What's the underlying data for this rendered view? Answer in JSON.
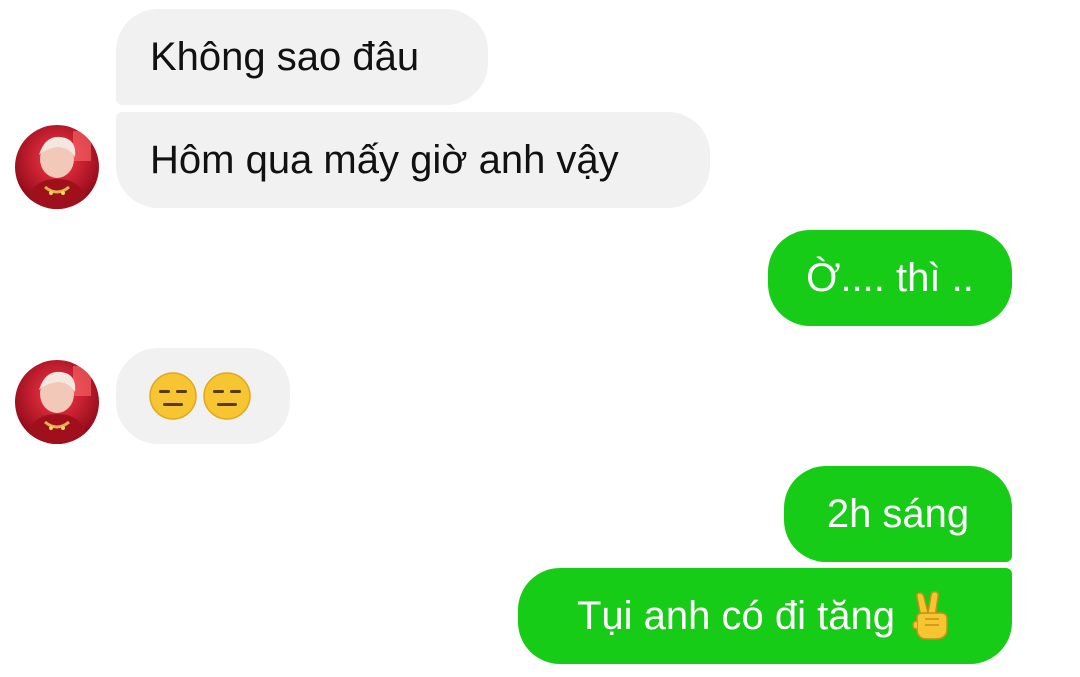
{
  "conversation": {
    "messages": [
      {
        "sender": "contact",
        "text": "Không sao đâu"
      },
      {
        "sender": "contact",
        "text": "Hôm qua mấy giờ anh vậy"
      },
      {
        "sender": "me",
        "text": "Ờ.... thì .."
      },
      {
        "sender": "contact",
        "emoji": [
          "expressionless-face",
          "expressionless-face"
        ]
      },
      {
        "sender": "me",
        "text": "2h sáng"
      },
      {
        "sender": "me",
        "text": "Tụi anh có đi tăng",
        "emoji": "victory-hand"
      }
    ]
  },
  "colors": {
    "incoming_bubble": "#f1f1f1",
    "outgoing_bubble": "#16cc16",
    "incoming_text": "#111111",
    "outgoing_text": "#ffffff"
  }
}
